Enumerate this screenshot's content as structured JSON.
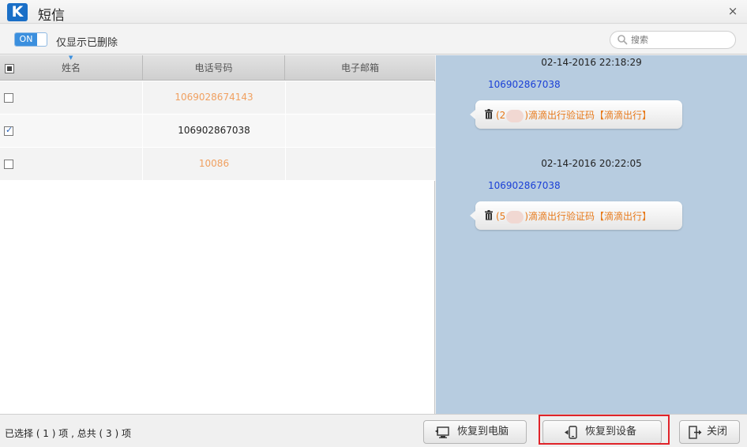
{
  "window": {
    "logo_letter": "K",
    "title": "短信",
    "close_glyph": "×"
  },
  "toolbar": {
    "toggle_state": "ON",
    "toggle_label": "仅显示已删除",
    "search_placeholder": "搜索"
  },
  "table": {
    "columns": [
      "姓名",
      "电话号码",
      "电子邮箱"
    ],
    "rows": [
      {
        "checked": false,
        "name": "",
        "phone": "1069028674143",
        "email": ""
      },
      {
        "checked": true,
        "name": "",
        "phone": "106902867038",
        "email": ""
      },
      {
        "checked": false,
        "name": "",
        "phone": "10086",
        "email": ""
      }
    ]
  },
  "messages": [
    {
      "time": "02-14-2016 22:18:29",
      "number": "106902867038",
      "prefix": "(2",
      "suffix": ")滴滴出行验证码【滴滴出行】"
    },
    {
      "time": "02-14-2016 20:22:05",
      "number": "106902867038",
      "prefix": "(5",
      "suffix": ")滴滴出行验证码【滴滴出行】"
    }
  ],
  "status": {
    "selection_text": "已选择 ( 1 ) 项 , 总共 ( 3 ) 项"
  },
  "buttons": {
    "restore_pc": "恢复到电脑",
    "restore_device": "恢复到设备",
    "close": "关闭"
  },
  "colors": {
    "accent": "#3b8fde",
    "message_pane": "#b7cce0",
    "phone_orange": "#f0a060",
    "message_number": "#1a3fd6",
    "message_text": "#e77a1c",
    "highlight": "#e0242a"
  }
}
